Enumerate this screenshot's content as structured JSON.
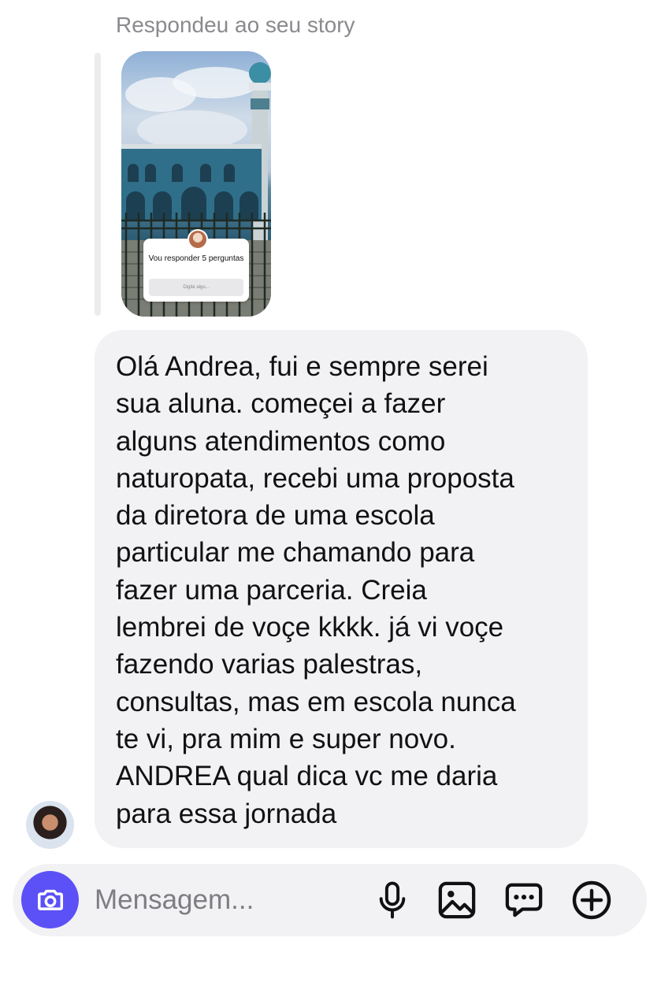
{
  "reply_header": {
    "label": "Respondeu ao seu story"
  },
  "story_preview": {
    "card_text": "Vou responder 5 perguntas",
    "card_input_placeholder": "Digite algo..."
  },
  "message": {
    "lines": [
      "Olá Andrea, fui e sempre serei",
      "sua aluna.  começei a fazer",
      "alguns atendimentos como",
      "naturopata, recebi uma proposta",
      "da diretora de uma escola",
      "particular me chamando para",
      "fazer uma parceria. Creia",
      "lembrei de voçe kkkk.  já vi voçe",
      "fazendo varias palestras,",
      "consultas, mas em escola nunca",
      "te vi, pra mim e super novo.",
      "ANDREA qual dica vc me daria",
      "para essa jornada"
    ]
  },
  "composer": {
    "placeholder": "Mensagem...",
    "icons": [
      "camera-icon",
      "microphone-icon",
      "image-icon",
      "sticker-chat-icon",
      "plus-circle-icon"
    ]
  },
  "colors": {
    "accent": "#5b51f6",
    "bubble": "#f2f2f5",
    "muted_text": "#8a8a8e"
  }
}
